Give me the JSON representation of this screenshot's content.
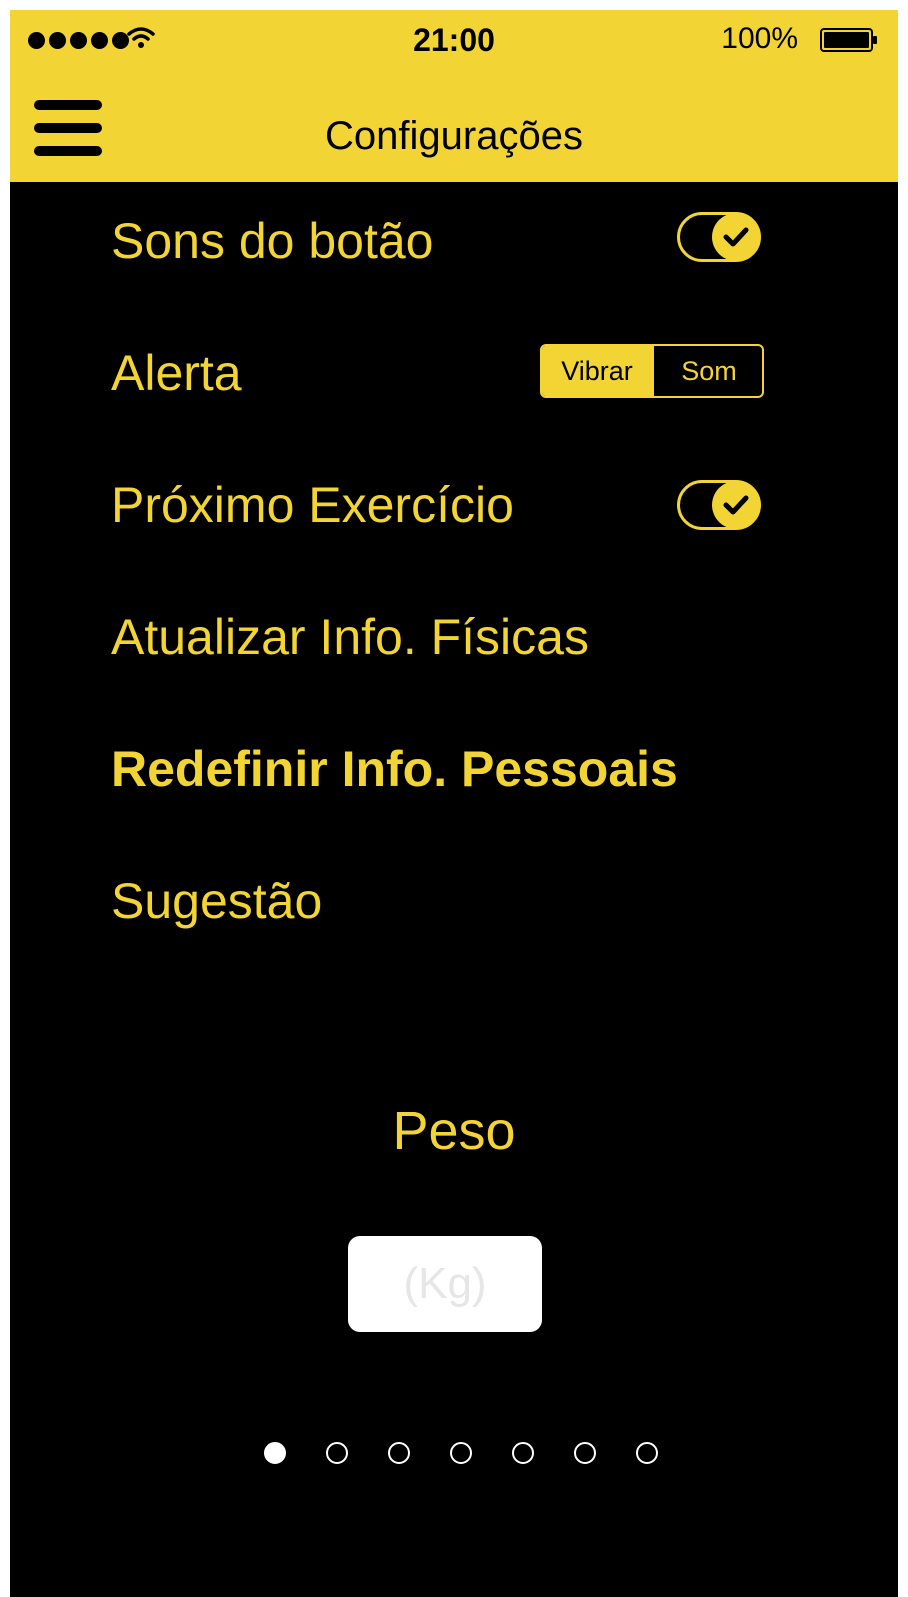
{
  "status_bar": {
    "time": "21:00",
    "battery_percent": "100%",
    "signal_bars": 5
  },
  "header": {
    "title": "Configurações",
    "menu_icon": "hamburger-menu-icon"
  },
  "settings": {
    "button_sounds": {
      "label": "Sons do botão",
      "enabled": true
    },
    "alert": {
      "label": "Alerta",
      "options": [
        "Vibrar",
        "Som"
      ],
      "selected": "Vibrar"
    },
    "next_exercise": {
      "label": "Próximo Exercício",
      "enabled": true
    },
    "update_physical": {
      "label": "Atualizar Info. Físicas"
    },
    "reset_personal": {
      "label": "Redefinir Info. Pessoais"
    },
    "suggestion": {
      "label": "Sugestão"
    }
  },
  "weight": {
    "label": "Peso",
    "placeholder": "(Kg)",
    "value": ""
  },
  "pagination": {
    "total_pages": 7,
    "current_page": 1
  },
  "colors": {
    "accent": "#F2D534",
    "background": "#000000",
    "input_background": "#FFFFFF"
  }
}
